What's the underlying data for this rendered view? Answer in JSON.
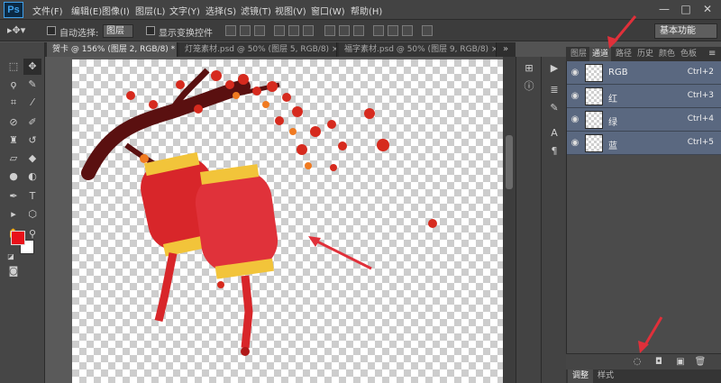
{
  "app": {
    "logo": "Ps"
  },
  "menu": [
    "文件(F)",
    "编辑(E)",
    "图像(I)",
    "图层(L)",
    "文字(Y)",
    "选择(S)",
    "滤镜(T)",
    "视图(V)",
    "窗口(W)",
    "帮助(H)"
  ],
  "window_controls": {
    "minimize": "—",
    "maximize": "□",
    "close": "✕"
  },
  "options_bar": {
    "auto_select_label": "自动选择:",
    "auto_select_value": "图层",
    "show_transform_label": "显示变换控件",
    "workspace": "基本功能"
  },
  "documents": [
    {
      "title": "贺卡 @ 156% (图层 2, RGB/8) *",
      "active": true
    },
    {
      "title": "灯笼素材.psd @ 50% (图层 5, RGB/8)",
      "active": false
    },
    {
      "title": "福字素材.psd @ 50% (图层 9, RGB/8)",
      "active": false
    }
  ],
  "panel_tabs": [
    "图层",
    "通道",
    "路径",
    "历史",
    "颜色",
    "色板"
  ],
  "active_panel_tab": "通道",
  "channels": [
    {
      "name": "RGB",
      "shortcut": "Ctrl+2"
    },
    {
      "name": "红",
      "shortcut": "Ctrl+3"
    },
    {
      "name": "绿",
      "shortcut": "Ctrl+4"
    },
    {
      "name": "蓝",
      "shortcut": "Ctrl+5"
    }
  ],
  "bottom_tabs": [
    "调整",
    "样式"
  ],
  "colors": {
    "foreground": "#e8111a",
    "background": "#ffffff",
    "selection_highlight": "#5a6880",
    "annotation_arrow": "#e0303a"
  }
}
